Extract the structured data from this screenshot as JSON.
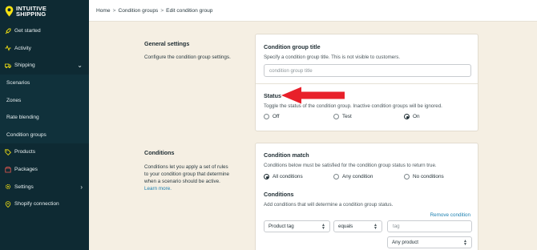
{
  "brand": {
    "line1": "INTUITIVE",
    "line2": "SHIPPING"
  },
  "sidebar": {
    "items": [
      {
        "label": "Get started",
        "icon": "rocket-icon"
      },
      {
        "label": "Activity",
        "icon": "activity-icon"
      },
      {
        "label": "Shipping",
        "icon": "truck-icon",
        "expanded": true
      },
      {
        "label": "Scenarios"
      },
      {
        "label": "Zones"
      },
      {
        "label": "Rate blending"
      },
      {
        "label": "Condition groups"
      },
      {
        "label": "Products",
        "icon": "tag-icon"
      },
      {
        "label": "Packages",
        "icon": "package-icon"
      },
      {
        "label": "Settings",
        "icon": "gear-icon"
      },
      {
        "label": "Shopify connection",
        "icon": "location-pin-icon"
      }
    ]
  },
  "breadcrumb": {
    "home": "Home",
    "parent": "Condition groups",
    "current": "Edit condition group",
    "sep": ">"
  },
  "general": {
    "label": "General settings",
    "description": "Configure the condition group settings."
  },
  "title_card": {
    "heading": "Condition group title",
    "help": "Specify a condition group title. This is not visible to customers.",
    "input_value": "",
    "input_placeholder": "condition group title"
  },
  "status_card": {
    "heading": "Status",
    "help": "Toggle the status of the condition group. Inactive condition groups will be ignored.",
    "options": [
      "Off",
      "Test",
      "On"
    ],
    "selected": "On"
  },
  "conditions_section": {
    "label": "Conditions",
    "description_line1": "Conditions let you apply a set of rules",
    "description_line2": "to your condition group that determine",
    "description_line3": "when a scenario should be active.",
    "learn_more": "Learn more."
  },
  "match_card": {
    "heading": "Condition match",
    "help": "Conditions below must be satisfied for the condition group status to return true.",
    "options": [
      "All conditions",
      "Any condition",
      "No conditions"
    ],
    "selected": "All conditions",
    "conditions_heading": "Conditions",
    "conditions_help": "Add conditions that will determine a condition group status.",
    "remove_label": "Remove condition",
    "row": {
      "field": "Product tag",
      "operator": "equals",
      "value_placeholder": "tag"
    },
    "product_select": "Any product"
  },
  "colors": {
    "sidebar": "#0e2a33",
    "accent": "#f6e312",
    "background": "#f5efe3",
    "link": "#1a7fb0",
    "arrow": "#e8202a"
  }
}
